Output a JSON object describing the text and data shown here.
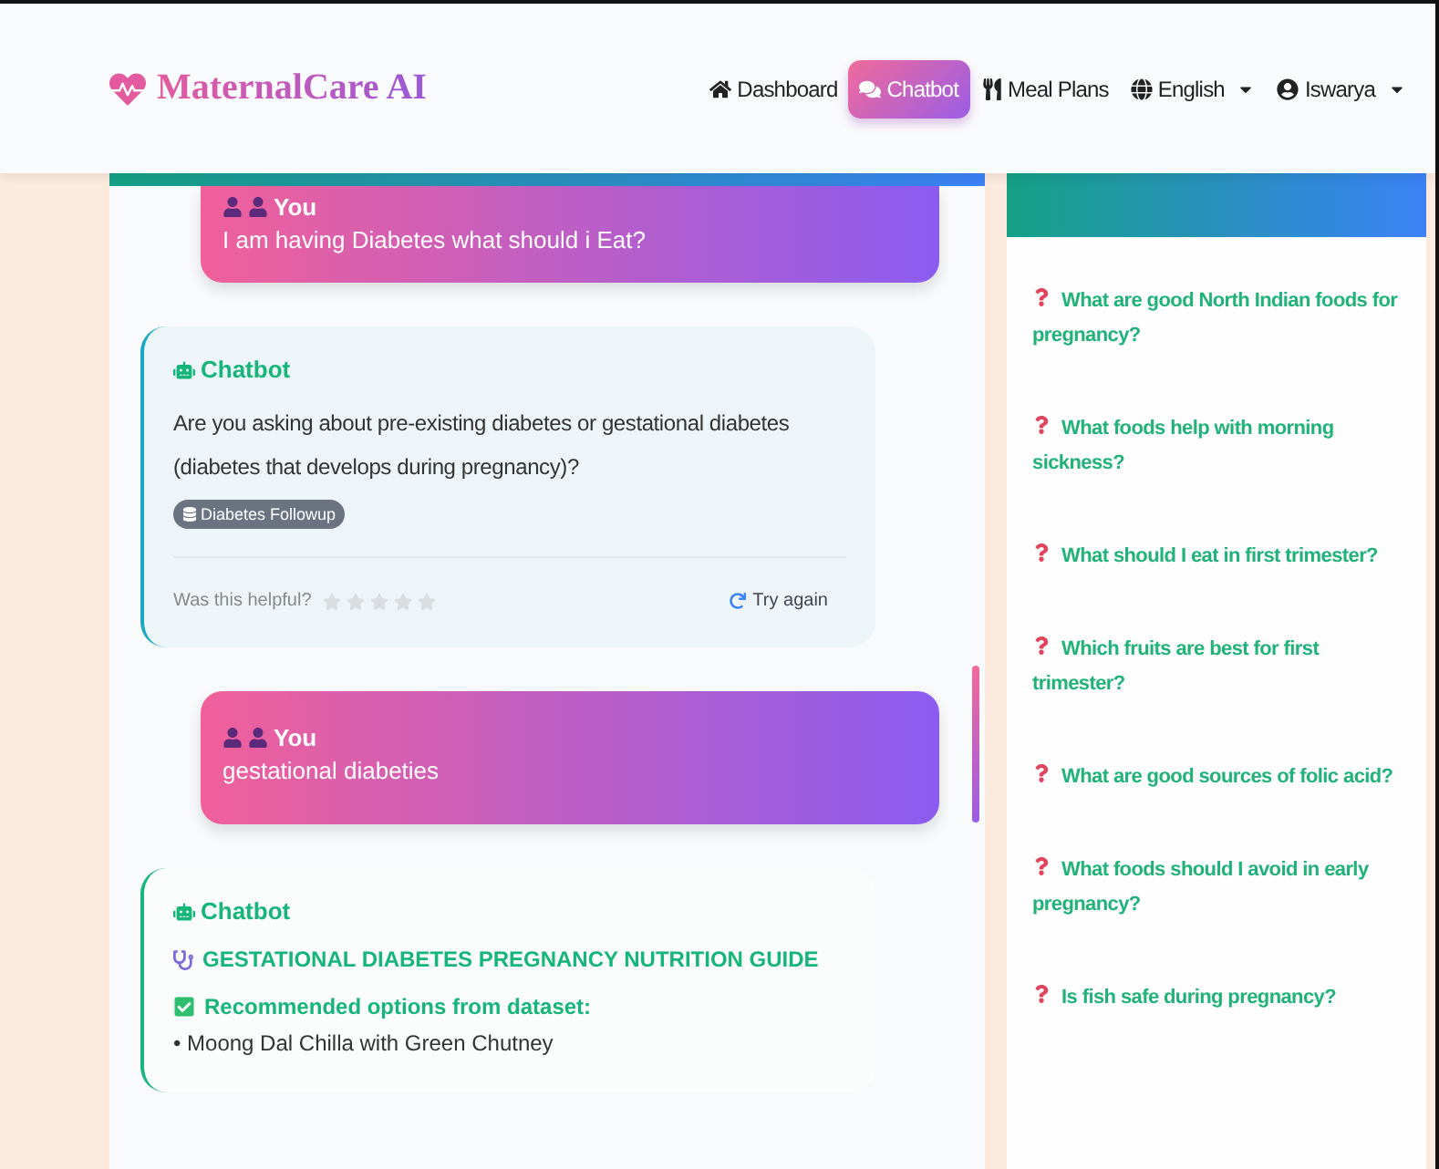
{
  "brand": {
    "name": "MaternalCare AI"
  },
  "nav": [
    {
      "label": "Dashboard",
      "selected": false,
      "dropdown": false
    },
    {
      "label": "Chatbot",
      "selected": true,
      "dropdown": false
    },
    {
      "label": "Meal Plans",
      "selected": false,
      "dropdown": false
    },
    {
      "label": "English",
      "selected": false,
      "dropdown": true
    },
    {
      "label": "Iswarya",
      "selected": false,
      "dropdown": true
    }
  ],
  "messages": [
    {
      "kind": "user",
      "author": "You",
      "text": "I am having Diabetes what should i Eat?"
    },
    {
      "kind": "bot",
      "author": "Chatbot",
      "text": "Are you asking about pre-existing diabetes or gestational diabetes (diabetes that develops during pregnancy)?",
      "tag": "Diabetes Followup",
      "feedback": {
        "question": "Was this helpful?",
        "stars": 0,
        "retry": "Try again"
      }
    },
    {
      "kind": "user",
      "author": "You",
      "text": "gestational diabeties"
    },
    {
      "kind": "bot",
      "author": "Chatbot",
      "heading": "GESTATIONAL DIABETES PREGNANCY NUTRITION GUIDE",
      "subheading": "Recommended options from dataset:",
      "items": [
        "• Moong Dal Chilla with Green Chutney"
      ]
    }
  ],
  "popular_questions": [
    "What are good North Indian foods for pregnancy?",
    "What foods help with morning sickness?",
    "What should I eat in first trimester?",
    "Which fruits are best for first trimester?",
    "What are good sources of folic acid?",
    "What foods should I avoid in early pregnancy?",
    "Is fish safe during pregnancy?"
  ]
}
